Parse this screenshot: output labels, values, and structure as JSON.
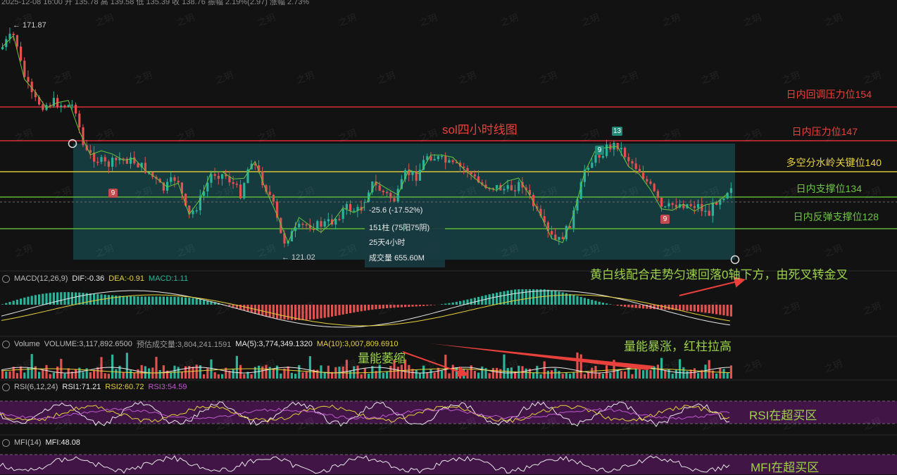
{
  "header": {
    "top_text": "2025-12-08 16:00  开 135.78  高 139.58  低 135.39  收 138.76  振幅 2.19%(2.97)  涨幅 2.73%"
  },
  "price": {
    "high_label": "← 171.87",
    "low_label": "← 121.02"
  },
  "chart_title": "sol四小时线图",
  "levels": {
    "r154": "日内回调压力位154",
    "r147": "日内压力位147",
    "k140": "多空分水岭关键位140",
    "s134": "日内支撑位134",
    "s128": "日内反弹支撑位128"
  },
  "colors": {
    "red_line": "#e02c3a",
    "yellow_line": "#d6c63a",
    "green_line": "#5fb33a",
    "up": "#2bb39a",
    "down": "#e2514f",
    "box": "#174a4e",
    "purple": "#4a1850"
  },
  "range_tooltip": {
    "change": "-25.6 (-17.52%)",
    "bars": "151柱 (75阳75阴)",
    "duration": "25天4小时",
    "volume": "成交量 655.60M"
  },
  "badges": {
    "b9a": "9",
    "b9b": "9",
    "b9c": "9",
    "b13": "13"
  },
  "macd": {
    "name": "MACD(12,26,9)",
    "dif": "DIF:-0.36",
    "dea": "DEA:-0.91",
    "macd": "MACD:1.11"
  },
  "volume": {
    "name": "Volume",
    "vol": "VOLUME:3,117,892.6500",
    "pred": "预估成交量:3,804,241.1591",
    "ma5": "MA(5):3,774,349.1320",
    "ma10": "MA(10):3,007,809.6910"
  },
  "rsi": {
    "name": "RSI(6,12,24)",
    "r1": "RSI1:71.21",
    "r2": "RSI2:60.72",
    "r3": "RSI3:54.59"
  },
  "mfi": {
    "name": "MFI(14)",
    "mfi": "MFI:48.08"
  },
  "annotations": {
    "macd_note": "黄白线配合走势匀速回落0轴下方，由死叉转金叉",
    "volume_up": "量能暴涨，红柱拉高",
    "volume_down": "量能萎缩",
    "rsi_note": "RSI在超买区",
    "mfi_note": "MFI在超买区"
  },
  "watermark": "之玥"
}
